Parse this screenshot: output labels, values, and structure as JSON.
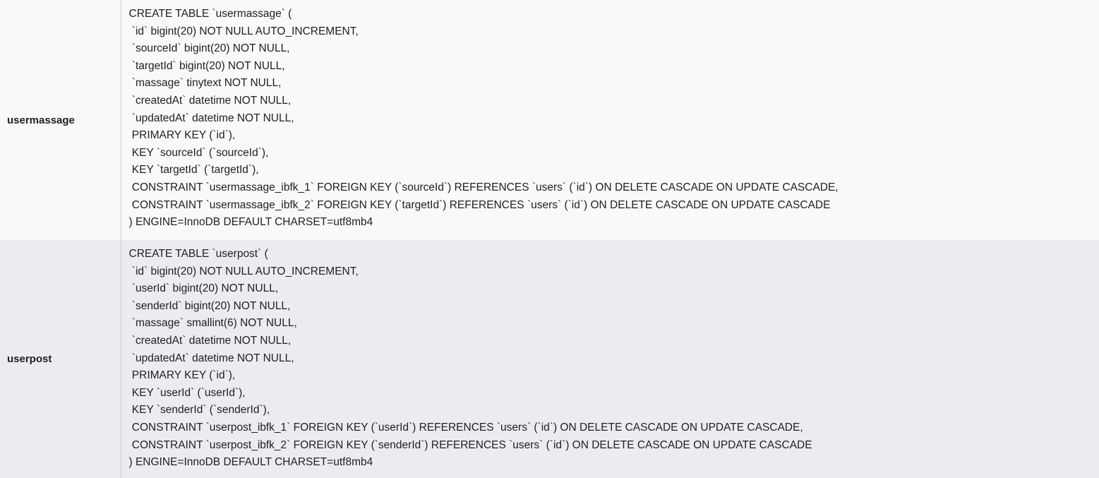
{
  "rows": [
    {
      "table_name": "usermassage",
      "sql_lines": [
        "CREATE TABLE `usermassage` (",
        " `id` bigint(20) NOT NULL AUTO_INCREMENT,",
        " `sourceId` bigint(20) NOT NULL,",
        " `targetId` bigint(20) NOT NULL,",
        " `massage` tinytext NOT NULL,",
        " `createdAt` datetime NOT NULL,",
        " `updatedAt` datetime NOT NULL,",
        " PRIMARY KEY (`id`),",
        " KEY `sourceId` (`sourceId`),",
        " KEY `targetId` (`targetId`),",
        " CONSTRAINT `usermassage_ibfk_1` FOREIGN KEY (`sourceId`) REFERENCES `users` (`id`) ON DELETE CASCADE ON UPDATE CASCADE,",
        " CONSTRAINT `usermassage_ibfk_2` FOREIGN KEY (`targetId`) REFERENCES `users` (`id`) ON DELETE CASCADE ON UPDATE CASCADE",
        ") ENGINE=InnoDB DEFAULT CHARSET=utf8mb4"
      ]
    },
    {
      "table_name": "userpost",
      "sql_lines": [
        "CREATE TABLE `userpost` (",
        " `id` bigint(20) NOT NULL AUTO_INCREMENT,",
        " `userId` bigint(20) NOT NULL,",
        " `senderId` bigint(20) NOT NULL,",
        " `massage` smallint(6) NOT NULL,",
        " `createdAt` datetime NOT NULL,",
        " `updatedAt` datetime NOT NULL,",
        " PRIMARY KEY (`id`),",
        " KEY `userId` (`userId`),",
        " KEY `senderId` (`senderId`),",
        " CONSTRAINT `userpost_ibfk_1` FOREIGN KEY (`userId`) REFERENCES `users` (`id`) ON DELETE CASCADE ON UPDATE CASCADE,",
        " CONSTRAINT `userpost_ibfk_2` FOREIGN KEY (`senderId`) REFERENCES `users` (`id`) ON DELETE CASCADE ON UPDATE CASCADE",
        ") ENGINE=InnoDB DEFAULT CHARSET=utf8mb4"
      ]
    }
  ]
}
